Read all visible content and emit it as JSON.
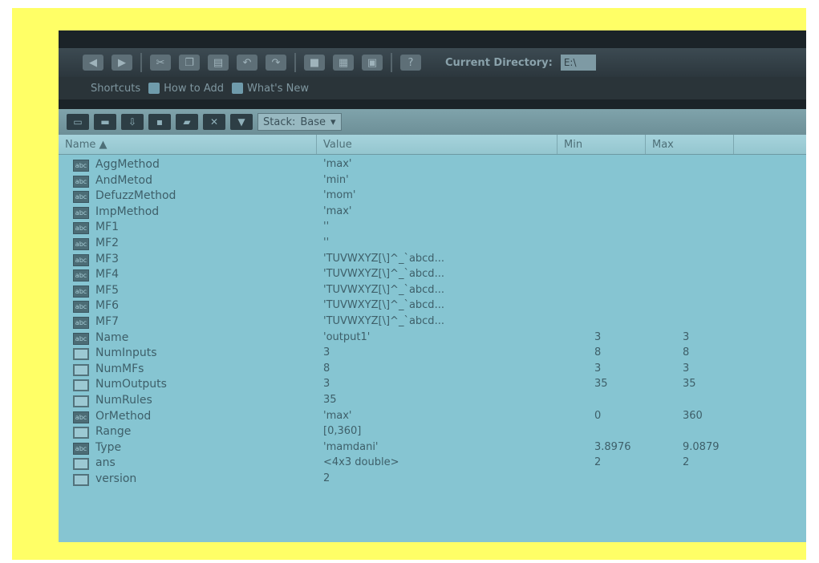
{
  "toolbar": {
    "current_dir_label": "Current Directory:",
    "dir_value": "E:\\",
    "shortcuts_label": "Shortcuts",
    "how_to_add": "How to Add",
    "whats_new": "What's New"
  },
  "workspace": {
    "stack_label": "Stack:",
    "stack_value": "Base",
    "columns": [
      "Name ▲",
      "Value",
      "Min",
      "Max"
    ],
    "rows": [
      {
        "name": "AggMethod",
        "value": "'max'",
        "min": "",
        "max": "",
        "kind": "text"
      },
      {
        "name": "AndMetod",
        "value": "'min'",
        "min": "",
        "max": "",
        "kind": "text"
      },
      {
        "name": "DefuzzMethod",
        "value": "'mom'",
        "min": "",
        "max": "",
        "kind": "text"
      },
      {
        "name": "ImpMethod",
        "value": "'max'",
        "min": "",
        "max": "",
        "kind": "text"
      },
      {
        "name": "MF1",
        "value": "''",
        "min": "",
        "max": "",
        "kind": "text"
      },
      {
        "name": "MF2",
        "value": "''",
        "min": "",
        "max": "",
        "kind": "text"
      },
      {
        "name": "MF3",
        "value": "'TUVWXYZ[\\]^_`abcd...",
        "min": "",
        "max": "",
        "kind": "text"
      },
      {
        "name": "MF4",
        "value": "'TUVWXYZ[\\]^_`abcd...",
        "min": "",
        "max": "",
        "kind": "text"
      },
      {
        "name": "MF5",
        "value": "'TUVWXYZ[\\]^_`abcd...",
        "min": "",
        "max": "",
        "kind": "text"
      },
      {
        "name": "MF6",
        "value": "'TUVWXYZ[\\]^_`abcd...",
        "min": "",
        "max": "",
        "kind": "text"
      },
      {
        "name": "MF7",
        "value": "'TUVWXYZ[\\]^_`abcd...",
        "min": "",
        "max": "",
        "kind": "text"
      },
      {
        "name": "Name",
        "value": "'output1'",
        "min": "3",
        "max": "3",
        "kind": "text"
      },
      {
        "name": "NumInputs",
        "value": "3",
        "min": "8",
        "max": "8",
        "kind": "num"
      },
      {
        "name": "NumMFs",
        "value": "8",
        "min": "3",
        "max": "3",
        "kind": "num"
      },
      {
        "name": "NumOutputs",
        "value": "3",
        "min": "35",
        "max": "35",
        "kind": "num"
      },
      {
        "name": "NumRules",
        "value": "35",
        "min": "",
        "max": "",
        "kind": "num"
      },
      {
        "name": "OrMethod",
        "value": "'max'",
        "min": "0",
        "max": "360",
        "kind": "text"
      },
      {
        "name": "Range",
        "value": "[0,360]",
        "min": "",
        "max": "",
        "kind": "num"
      },
      {
        "name": "Type",
        "value": "'mamdani'",
        "min": "3.8976",
        "max": "9.0879",
        "kind": "text"
      },
      {
        "name": "ans",
        "value": "<4x3 double>",
        "min": "2",
        "max": "2",
        "kind": "num"
      },
      {
        "name": "version",
        "value": "2",
        "min": "",
        "max": "",
        "kind": "num"
      }
    ]
  },
  "colors": {
    "frame": "#ffff66",
    "grid_bg": "#86c5d2"
  },
  "icons": {
    "text_var": "char-variable-icon",
    "num_var": "matrix-variable-icon"
  }
}
